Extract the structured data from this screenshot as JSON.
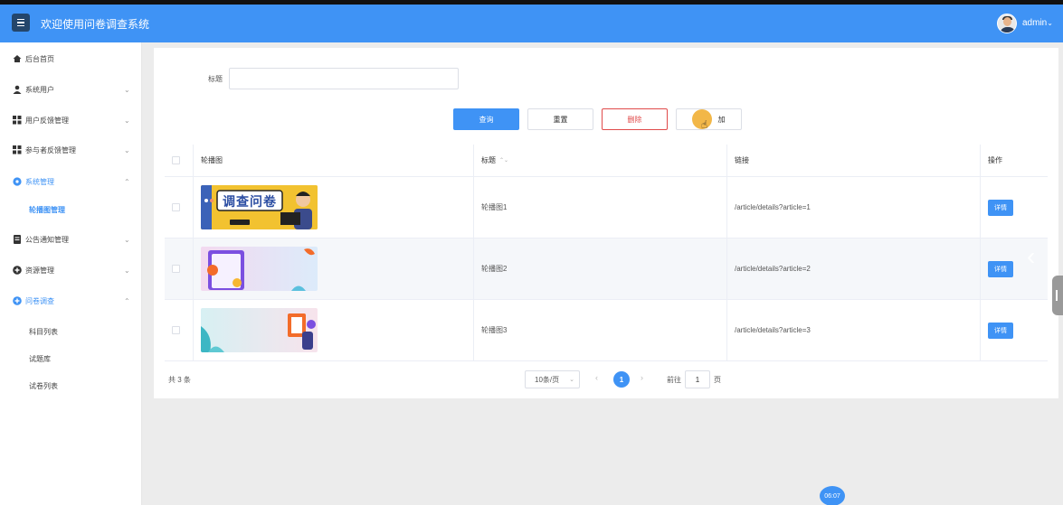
{
  "header": {
    "title": "欢迎使用问卷调查系统",
    "user_name": "admin",
    "user_chevron": "⌄"
  },
  "sidebar": {
    "items": [
      {
        "label": "后台首页",
        "icon": "home-icon"
      },
      {
        "label": "系统用户",
        "icon": "user-icon",
        "arrow": "⌄"
      },
      {
        "label": "用户反馈管理",
        "icon": "grid-icon",
        "arrow": "⌄"
      },
      {
        "label": "参与者反馈管理",
        "icon": "grid-icon",
        "arrow": "⌄"
      },
      {
        "label": "系统管理",
        "icon": "gear-icon",
        "arrow": "⌃"
      },
      {
        "label": "公告通知管理",
        "icon": "document-icon",
        "arrow": "⌄"
      },
      {
        "label": "资源管理",
        "icon": "plus-circle-icon",
        "arrow": "⌄"
      },
      {
        "label": "问卷调查",
        "icon": "plus-circle-icon",
        "arrow": "⌃"
      }
    ],
    "sub_system": [
      {
        "label": "轮播图管理"
      }
    ],
    "sub_survey": [
      {
        "label": "科目列表"
      },
      {
        "label": "试题库"
      },
      {
        "label": "试卷列表"
      }
    ]
  },
  "search": {
    "label": "标题",
    "value": ""
  },
  "toolbar": {
    "query_label": "查询",
    "reset_label": "重置",
    "delete_label": "删除",
    "add_label": "添加",
    "add_visible": "加"
  },
  "table": {
    "headers": [
      "轮播图",
      "标题",
      "链接",
      "操作"
    ],
    "sort_glyph": "⌃⌄",
    "rows": [
      {
        "title": "轮播图1",
        "link": "/article/details?article=1",
        "action": "详情",
        "thumb_text": "调查问卷"
      },
      {
        "title": "轮播图2",
        "link": "/article/details?article=2",
        "action": "详情"
      },
      {
        "title": "轮播图3",
        "link": "/article/details?article=3",
        "action": "详情"
      }
    ]
  },
  "pagination": {
    "total": "共 3 条",
    "page_size": "10条/页",
    "prev": "‹",
    "current_page": "1",
    "next": "›",
    "goto_label": "前往",
    "goto_value": "1",
    "goto_suffix": "页"
  },
  "overlay": {
    "carousel_arrow": "‹",
    "timer": "06:07"
  },
  "colors": {
    "primary": "#3f93f5",
    "danger": "#e04a4a",
    "header_dark": "#24466b"
  }
}
